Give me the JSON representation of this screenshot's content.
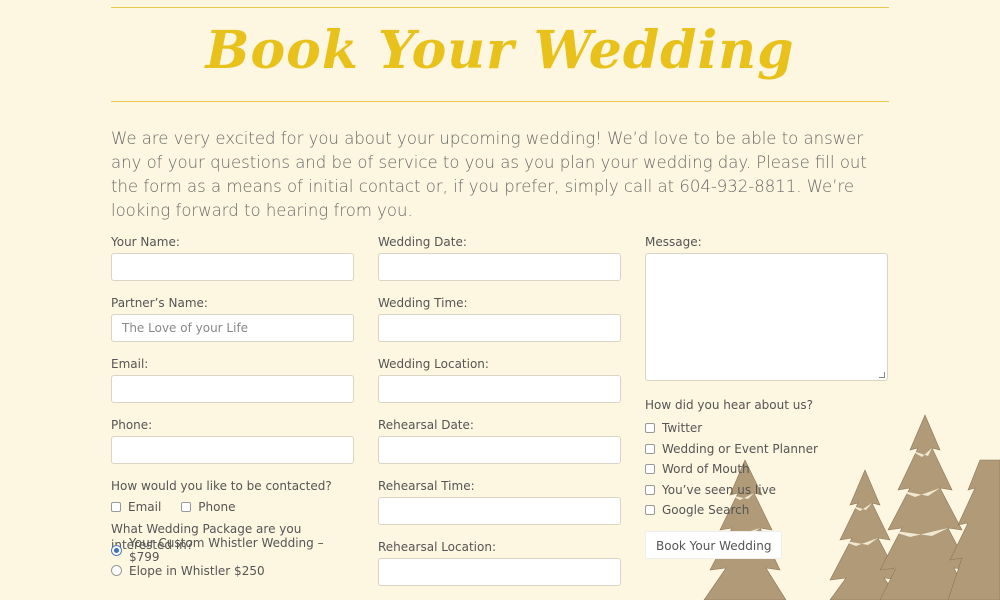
{
  "page": {
    "title": "Book Your Wedding",
    "intro": "We are very excited for you about your upcoming wedding! We’d love to be able to answer any of your questions and be of service to you as you plan your wedding day. Please fill out the form as a means of initial contact or, if you prefer, simply call at 604-932-8811. We’re looking forward to hearing from you."
  },
  "form": {
    "col1": {
      "your_name": {
        "label": "Your Name:",
        "value": "",
        "placeholder": ""
      },
      "partner_name": {
        "label": "Partner’s Name:",
        "value": "",
        "placeholder": "The Love of your Life"
      },
      "email": {
        "label": "Email:",
        "value": "",
        "placeholder": ""
      },
      "phone": {
        "label": "Phone:",
        "value": "",
        "placeholder": ""
      },
      "contact_method": {
        "label": "How would you like to be contacted?",
        "options": [
          "Email",
          "Phone"
        ]
      },
      "package": {
        "label": "What Wedding Package are you interested in?",
        "options": [
          "Your Custom Whistler Wedding – $799",
          "Elope in Whistler $250"
        ],
        "selected": 0
      }
    },
    "col2": {
      "wedding_date": {
        "label": "Wedding Date:",
        "value": ""
      },
      "wedding_time": {
        "label": "Wedding Time:",
        "value": ""
      },
      "wedding_location": {
        "label": "Wedding Location:",
        "value": ""
      },
      "rehearsal_date": {
        "label": "Rehearsal Date:",
        "value": ""
      },
      "rehearsal_time": {
        "label": "Rehearsal Time:",
        "value": ""
      },
      "rehearsal_location": {
        "label": "Rehearsal Location:",
        "value": ""
      }
    },
    "col3": {
      "message": {
        "label": "Message:",
        "value": ""
      },
      "hear_about": {
        "label": "How did you hear about us?",
        "options": [
          "Twitter",
          "Wedding or Event Planner",
          "Word of Mouth",
          "You’ve seen us live",
          "Google Search"
        ]
      },
      "submit_label": "Book Your Wedding"
    }
  },
  "colors": {
    "background": "#fdf6e0",
    "accent": "#e8c11a"
  },
  "decor": {
    "trees": "snowy-pine-trees-illustration"
  }
}
